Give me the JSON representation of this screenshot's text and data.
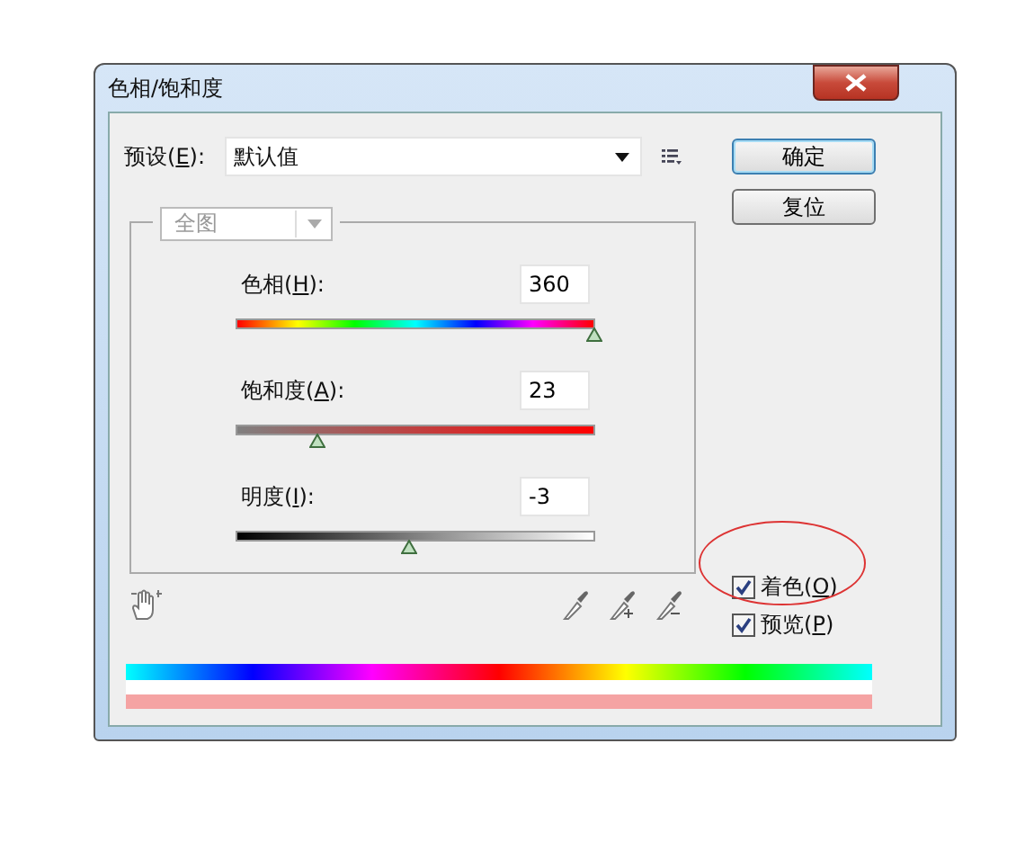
{
  "window": {
    "title": "色相/饱和度"
  },
  "preset": {
    "label_before": "预设(",
    "access_key": "E",
    "label_after": "):",
    "value": "默认值"
  },
  "buttons": [
    {
      "label": "确定",
      "default": true
    },
    {
      "label": "复位",
      "default": false
    }
  ],
  "channel": {
    "value": "全图",
    "disabled": true
  },
  "sliders": [
    {
      "kind": "hue",
      "label_before": "色相(",
      "access_key": "H",
      "label_after": "):",
      "value": "360",
      "level": 1.0
    },
    {
      "kind": "saturation",
      "label_before": "饱和度(",
      "access_key": "A",
      "label_after": "):",
      "value": "23",
      "level": 0.23
    },
    {
      "kind": "lightness",
      "label_before": "明度(",
      "access_key": "I",
      "label_after": "):",
      "value": "-3",
      "level": 0.485
    }
  ],
  "checkboxes": [
    {
      "label_before": "着色(",
      "access_key": "O",
      "label_after": ")",
      "checked": true
    },
    {
      "label_before": "预览(",
      "access_key": "P",
      "label_after": ")",
      "checked": true
    }
  ]
}
